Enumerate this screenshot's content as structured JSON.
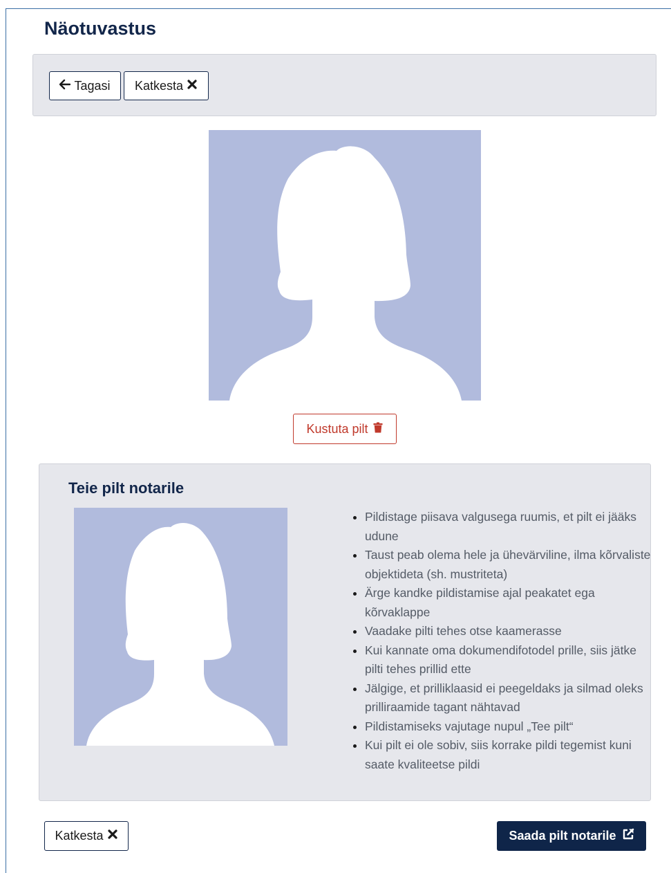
{
  "page": {
    "title": "Näotuvastus"
  },
  "toolbar": {
    "back_label": "Tagasi",
    "back_icon": "arrow-left-icon",
    "cancel_label": "Katkesta",
    "cancel_icon": "close-icon"
  },
  "photo": {
    "placeholder_bg": "#b1bbdd",
    "delete_label": "Kustuta pilt",
    "delete_icon": "trash-icon",
    "delete_color": "#c0392b"
  },
  "panel": {
    "title": "Teie pilt notarile",
    "instructions": [
      "Pildistage piisava valgusega ruumis, et pilt ei jääks udune",
      "Taust peab olema hele ja ühevärviline, ilma kõrvaliste objektideta (sh. mustriteta)",
      "Ärge kandke pildistamise ajal peakatet ega kõrvaklappe",
      "Vaadake pilti tehes otse kaamerasse",
      "Kui kannate oma dokumendifotodel prille, siis jätke pilti tehes prillid ette",
      "Jälgige, et prilliklaasid ei peegeldaks ja silmad oleks prilliraamide tagant nähtavad",
      "Pildistamiseks vajutage nupul „Tee pilt“",
      "Kui pilt ei ole sobiv, siis korrake pildi tegemist kuni saate kvaliteetse pildi"
    ]
  },
  "footer": {
    "cancel_label": "Katkesta",
    "send_label": "Saada pilt notarile",
    "send_icon": "external-link-icon",
    "send_bg": "#0f2549"
  }
}
